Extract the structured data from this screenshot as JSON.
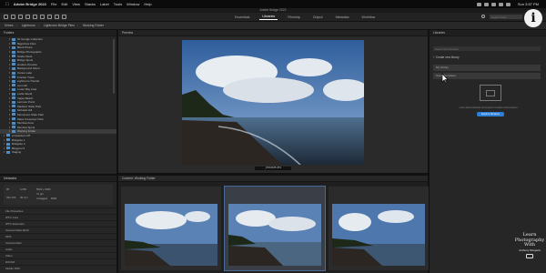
{
  "menubar": {
    "items": [
      "Adobe Bridge 2022",
      "File",
      "Edit",
      "View",
      "Stacks",
      "Label",
      "Tools",
      "Window",
      "Help"
    ],
    "clock": "Sun 3:57 PM"
  },
  "app": {
    "window_title": "Adobe Bridge 2022"
  },
  "toolbar": {
    "workspaces": [
      "Essentials",
      "Libraries",
      "Filmstrip",
      "Output",
      "Metadata",
      "Workflow"
    ],
    "active_workspace": "Libraries",
    "search_placeholder": "Search Files"
  },
  "pathbar": {
    "crumbs": [
      "Drives",
      "Lightroom",
      "Lightroom Bridge Files",
      "Working Folder"
    ]
  },
  "folders": {
    "header": "Folders",
    "items": [
      "01 Google Collection",
      "Bigpicture Files",
      "Block Phone",
      "Bridge Photographs",
      "Studio Work",
      "Bridge Spots",
      "Hudson Preview",
      "Background Shoot",
      "Canoe Lake",
      "Frontier Trees",
      "Lightroom Tutorial",
      "Lion Hill",
      "Lower Bay Area",
      "Lottie Island",
      "Ingles Beach",
      "Larmore Pond",
      "Madison State Park",
      "Mohawk Hill",
      "Monument State Park",
      "Mass Crossover Park",
      "Mumbai Area",
      "Mumbai Spots",
      "Working Folder"
    ],
    "selected_item": "Working Folder",
    "extra_items": [
      "Amsterdam Off",
      "Bridgette 1",
      "Bridgette 2",
      "Blogpost 3",
      "Staging"
    ]
  },
  "metadata": {
    "header": "Metadata",
    "summary": {
      "aperture": "f/8",
      "shutter": "1/250",
      "iso": "ISO 100",
      "focal": "35 mm",
      "size": "5504 x 3096",
      "resolution": "72 ppi",
      "profile": "Untagged",
      "mode": "RGB"
    },
    "sections": [
      "File Properties",
      "IPTC Core",
      "IPTC Extension",
      "Camera Data (Exif)",
      "GPS",
      "Camera Raw",
      "Audio",
      "Video",
      "DICOM",
      "Mobile SDK"
    ]
  },
  "preview": {
    "header": "Preview",
    "filename": "_DSC2645.JPG"
  },
  "content": {
    "header": "Content: Working Folder",
    "thumbnails": 3,
    "selected_index": 1
  },
  "libraries": {
    "header": "Libraries",
    "search_placeholder": "Search All Libraries",
    "create_label": "Create new library",
    "row1": "My Library",
    "row2": "Stock Templates",
    "body_text": "Learn about libraries and explore Creative Cloud assets.",
    "explore_button": "Explore libraries"
  },
  "watermark": {
    "lines": [
      "Learn",
      "Photography",
      "With",
      "Anthony Morganti"
    ]
  },
  "colors": {
    "accent": "#2d7fd8",
    "folder_icon": "#4a8fc8",
    "background": "#262626"
  }
}
